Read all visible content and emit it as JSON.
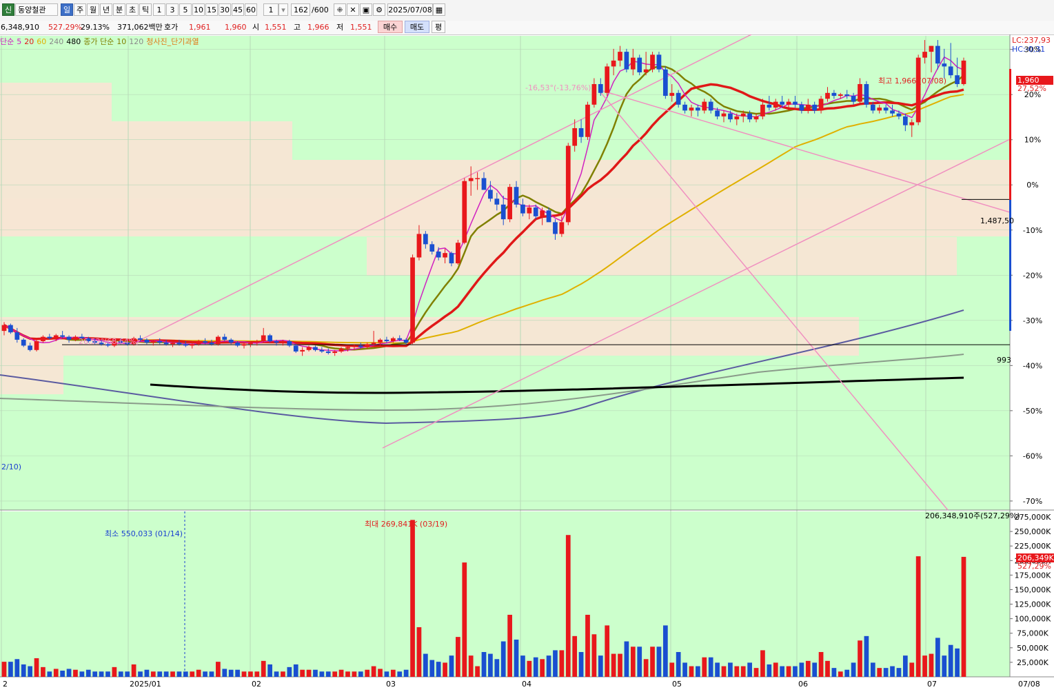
{
  "toolbar": {
    "badge": "신",
    "stock_name": "동양철관",
    "periods": [
      "일",
      "주",
      "월",
      "년",
      "분",
      "초",
      "틱"
    ],
    "active_period": "일",
    "intervals": [
      "1",
      "3",
      "5",
      "10",
      "15",
      "30",
      "45",
      "60"
    ],
    "unit_value": "1",
    "count_value": "162",
    "count_max": "/600",
    "date_value": "2025/07/08"
  },
  "quote": {
    "volume": "6,348,910",
    "volume_ratio": "527.29%",
    "change_pct": "29.13%",
    "trade_amount": "371,062백만",
    "ask_label": "호가",
    "ask": "1,961",
    "bid": "1,960",
    "open_label": "시",
    "open": "1,551",
    "high_label": "고",
    "high": "1,966",
    "low_label": "저",
    "low": "1,551",
    "buy_button": "매수",
    "sell_button": "매도",
    "eval_button": "평"
  },
  "legend": {
    "ma_label": "단순",
    "ma5": "5",
    "ma20": "20",
    "ma60": "60",
    "ma240": "240",
    "ma480": "480",
    "vol_label": "종가 단순",
    "vma10": "10",
    "vma120": "120",
    "signal": "청사진_단기과열"
  },
  "colors": {
    "ma5": "#d020c0",
    "ma20": "#e01818",
    "ma60": "#e0b000",
    "ma120": "#808000",
    "ma240": "#5a5aa0",
    "ma480": "#000000",
    "up": "#e8181c",
    "down": "#1a4fd0",
    "plot_bg": "#ccffcc",
    "band": "#f7e6d4",
    "trend": "#f090c0"
  },
  "right_axis": {
    "lc": "LC:237,93",
    "hc": "HC:-0,31",
    "current_price": "1,960",
    "current_pct": "27,52%",
    "level_mid": "1,487,50",
    "level_low": "993",
    "vol_top": "206,348,910주(527,29%)",
    "vol_current": "206,349K",
    "vol_current_pct": "527,29%"
  },
  "annotations": {
    "max_price": "최고 1,966 (07/08)",
    "min_price": "2/10)",
    "trend_left": "26,53°(68,64%)",
    "trend_top": "-16,53°(-13,76%)",
    "vol_max": "최대 269,841K (03/19)",
    "vol_min": "최소 550,033 (01/14)"
  },
  "chart_data": {
    "type": "candlestick",
    "price_axis_pct_ticks": [
      "30%",
      "20%",
      "10%",
      "0%",
      "-10%",
      "-20%",
      "-30%",
      "-40%",
      "-50%",
      "-60%",
      "-70%"
    ],
    "volume_axis_ticks": [
      "275,000K",
      "250,000K",
      "225,000K",
      "200,000K",
      "175,000K",
      "150,000K",
      "125,000K",
      "100,000K",
      "75,000K",
      "50,000K",
      "25,000K"
    ],
    "x_ticks": [
      "2",
      "2025/01",
      "02",
      "03",
      "04",
      "05",
      "06",
      "07",
      "07/08"
    ],
    "reference_price": 1537,
    "last_close": 1960,
    "high": 1966,
    "high_date": "07/08",
    "levels": [
      1487.5,
      993
    ],
    "volume_max": 269841,
    "volume_max_date": "03/19",
    "volume_min": 550.033,
    "volume_min_date": "01/14",
    "volume_last": 206349,
    "candles": [
      [
        1040,
        1070,
        1025,
        1060
      ],
      [
        1060,
        1065,
        1030,
        1035
      ],
      [
        1035,
        1050,
        1000,
        1010
      ],
      [
        1010,
        1015,
        985,
        990
      ],
      [
        990,
        1000,
        970,
        975
      ],
      [
        975,
        1015,
        970,
        1005
      ],
      [
        1005,
        1025,
        1000,
        1020
      ],
      [
        1020,
        1030,
        1010,
        1015
      ],
      [
        1015,
        1030,
        1005,
        1025
      ],
      [
        1025,
        1040,
        1015,
        1020
      ],
      [
        1020,
        1025,
        1000,
        1010
      ],
      [
        1010,
        1025,
        1005,
        1020
      ],
      [
        1020,
        1030,
        1010,
        1015
      ],
      [
        1015,
        1020,
        1000,
        1005
      ],
      [
        1005,
        1015,
        995,
        1000
      ],
      [
        1000,
        1010,
        990,
        995
      ],
      [
        995,
        1005,
        985,
        990
      ],
      [
        990,
        1010,
        985,
        1005
      ],
      [
        1005,
        1015,
        995,
        1000
      ],
      [
        1000,
        1010,
        990,
        995
      ],
      [
        995,
        1020,
        990,
        1015
      ],
      [
        1015,
        1025,
        1005,
        1010
      ],
      [
        1010,
        1015,
        995,
        1000
      ],
      [
        1000,
        1010,
        990,
        1005
      ],
      [
        1005,
        1015,
        995,
        1000
      ],
      [
        1000,
        1010,
        990,
        995
      ],
      [
        995,
        1005,
        985,
        1000
      ],
      [
        1000,
        1010,
        990,
        995
      ],
      [
        995,
        1005,
        985,
        990
      ],
      [
        990,
        1000,
        980,
        995
      ],
      [
        995,
        1010,
        990,
        1005
      ],
      [
        1005,
        1015,
        995,
        1000
      ],
      [
        1000,
        1010,
        990,
        995
      ],
      [
        995,
        1025,
        990,
        1020
      ],
      [
        1020,
        1030,
        1005,
        1010
      ],
      [
        1010,
        1015,
        995,
        1000
      ],
      [
        1000,
        1005,
        985,
        990
      ],
      [
        990,
        1000,
        980,
        995
      ],
      [
        995,
        1005,
        985,
        1000
      ],
      [
        1000,
        1010,
        990,
        1005
      ],
      [
        1005,
        1050,
        1000,
        1025
      ],
      [
        1025,
        1030,
        1000,
        1005
      ],
      [
        1005,
        1010,
        990,
        1000
      ],
      [
        1000,
        1010,
        990,
        1005
      ],
      [
        1005,
        1010,
        985,
        990
      ],
      [
        990,
        995,
        965,
        970
      ],
      [
        970,
        985,
        955,
        975
      ],
      [
        975,
        990,
        970,
        985
      ],
      [
        985,
        990,
        970,
        975
      ],
      [
        975,
        985,
        965,
        970
      ],
      [
        970,
        980,
        960,
        965
      ],
      [
        965,
        975,
        955,
        970
      ],
      [
        970,
        985,
        965,
        980
      ],
      [
        980,
        990,
        970,
        985
      ],
      [
        985,
        995,
        975,
        990
      ],
      [
        990,
        1000,
        980,
        985
      ],
      [
        985,
        1000,
        980,
        995
      ],
      [
        995,
        1040,
        990,
        1000
      ],
      [
        1000,
        1015,
        990,
        1010
      ],
      [
        1010,
        1020,
        1000,
        1005
      ],
      [
        1005,
        1020,
        1000,
        1015
      ],
      [
        1015,
        1025,
        1005,
        1010
      ],
      [
        1010,
        1015,
        995,
        1000
      ],
      [
        1000,
        1300,
        995,
        1290
      ],
      [
        1290,
        1400,
        1280,
        1370
      ],
      [
        1370,
        1380,
        1320,
        1335
      ],
      [
        1335,
        1345,
        1300,
        1310
      ],
      [
        1310,
        1325,
        1280,
        1290
      ],
      [
        1290,
        1320,
        1270,
        1305
      ],
      [
        1305,
        1310,
        1260,
        1270
      ],
      [
        1270,
        1350,
        1265,
        1340
      ],
      [
        1340,
        1560,
        1335,
        1550
      ],
      [
        1550,
        1600,
        1500,
        1560
      ],
      [
        1560,
        1580,
        1520,
        1560
      ],
      [
        1560,
        1580,
        1520,
        1520
      ],
      [
        1520,
        1550,
        1480,
        1490
      ],
      [
        1490,
        1510,
        1450,
        1470
      ],
      [
        1470,
        1500,
        1400,
        1420
      ],
      [
        1420,
        1540,
        1410,
        1530
      ],
      [
        1530,
        1550,
        1460,
        1470
      ],
      [
        1470,
        1490,
        1430,
        1440
      ],
      [
        1440,
        1470,
        1420,
        1460
      ],
      [
        1460,
        1470,
        1420,
        1430
      ],
      [
        1430,
        1460,
        1400,
        1450
      ],
      [
        1450,
        1460,
        1420,
        1410
      ],
      [
        1410,
        1420,
        1350,
        1370
      ],
      [
        1370,
        1430,
        1360,
        1410
      ],
      [
        1410,
        1680,
        1400,
        1670
      ],
      [
        1670,
        1760,
        1650,
        1730
      ],
      [
        1730,
        1760,
        1680,
        1700
      ],
      [
        1700,
        1820,
        1690,
        1810
      ],
      [
        1810,
        1900,
        1800,
        1880
      ],
      [
        1880,
        1900,
        1840,
        1850
      ],
      [
        1850,
        1950,
        1840,
        1940
      ],
      [
        1940,
        2000,
        1910,
        1960
      ],
      [
        1960,
        2010,
        1940,
        1990
      ],
      [
        1990,
        2000,
        1920,
        1930
      ],
      [
        1930,
        2000,
        1910,
        1970
      ],
      [
        1970,
        1980,
        1910,
        1920
      ],
      [
        1920,
        1990,
        1910,
        1930
      ],
      [
        1930,
        1990,
        1920,
        1980
      ],
      [
        1980,
        1990,
        1920,
        1930
      ],
      [
        1930,
        1940,
        1830,
        1840
      ],
      [
        1840,
        1880,
        1820,
        1850
      ],
      [
        1850,
        1860,
        1800,
        1810
      ],
      [
        1810,
        1820,
        1780,
        1790
      ],
      [
        1790,
        1810,
        1770,
        1800
      ],
      [
        1800,
        1810,
        1770,
        1790
      ],
      [
        1790,
        1830,
        1780,
        1820
      ],
      [
        1820,
        1830,
        1780,
        1790
      ],
      [
        1790,
        1800,
        1760,
        1770
      ],
      [
        1770,
        1790,
        1750,
        1780
      ],
      [
        1780,
        1790,
        1750,
        1760
      ],
      [
        1760,
        1780,
        1740,
        1770
      ],
      [
        1770,
        1790,
        1750,
        1780
      ],
      [
        1780,
        1790,
        1750,
        1760
      ],
      [
        1760,
        1780,
        1750,
        1770
      ],
      [
        1770,
        1830,
        1760,
        1810
      ],
      [
        1810,
        1840,
        1790,
        1800
      ],
      [
        1800,
        1830,
        1790,
        1820
      ],
      [
        1820,
        1840,
        1800,
        1810
      ],
      [
        1810,
        1830,
        1790,
        1820
      ],
      [
        1820,
        1840,
        1800,
        1810
      ],
      [
        1810,
        1820,
        1780,
        1790
      ],
      [
        1790,
        1830,
        1780,
        1810
      ],
      [
        1810,
        1820,
        1780,
        1790
      ],
      [
        1790,
        1840,
        1780,
        1830
      ],
      [
        1830,
        1870,
        1820,
        1850
      ],
      [
        1850,
        1860,
        1830,
        1840
      ],
      [
        1840,
        1850,
        1830,
        1845
      ],
      [
        1845,
        1860,
        1830,
        1840
      ],
      [
        1840,
        1850,
        1810,
        1820
      ],
      [
        1820,
        1900,
        1815,
        1880
      ],
      [
        1880,
        1890,
        1800,
        1810
      ],
      [
        1810,
        1820,
        1780,
        1790
      ],
      [
        1790,
        1810,
        1780,
        1800
      ],
      [
        1800,
        1810,
        1780,
        1790
      ],
      [
        1790,
        1810,
        1770,
        1780
      ],
      [
        1780,
        1790,
        1760,
        1770
      ],
      [
        1770,
        1780,
        1720,
        1740
      ],
      [
        1740,
        1760,
        1700,
        1750
      ],
      [
        1750,
        1980,
        1740,
        1970
      ],
      [
        1970,
        2030,
        1950,
        1990
      ],
      [
        1990,
        2010,
        1920,
        2010
      ],
      [
        2010,
        2030,
        1930,
        1950
      ],
      [
        1950,
        2000,
        1900,
        1940
      ],
      [
        1940,
        2020,
        1900,
        1910
      ],
      [
        1910,
        1970,
        1870,
        1880
      ],
      [
        1880,
        1970,
        1875,
        1960
      ]
    ]
  }
}
